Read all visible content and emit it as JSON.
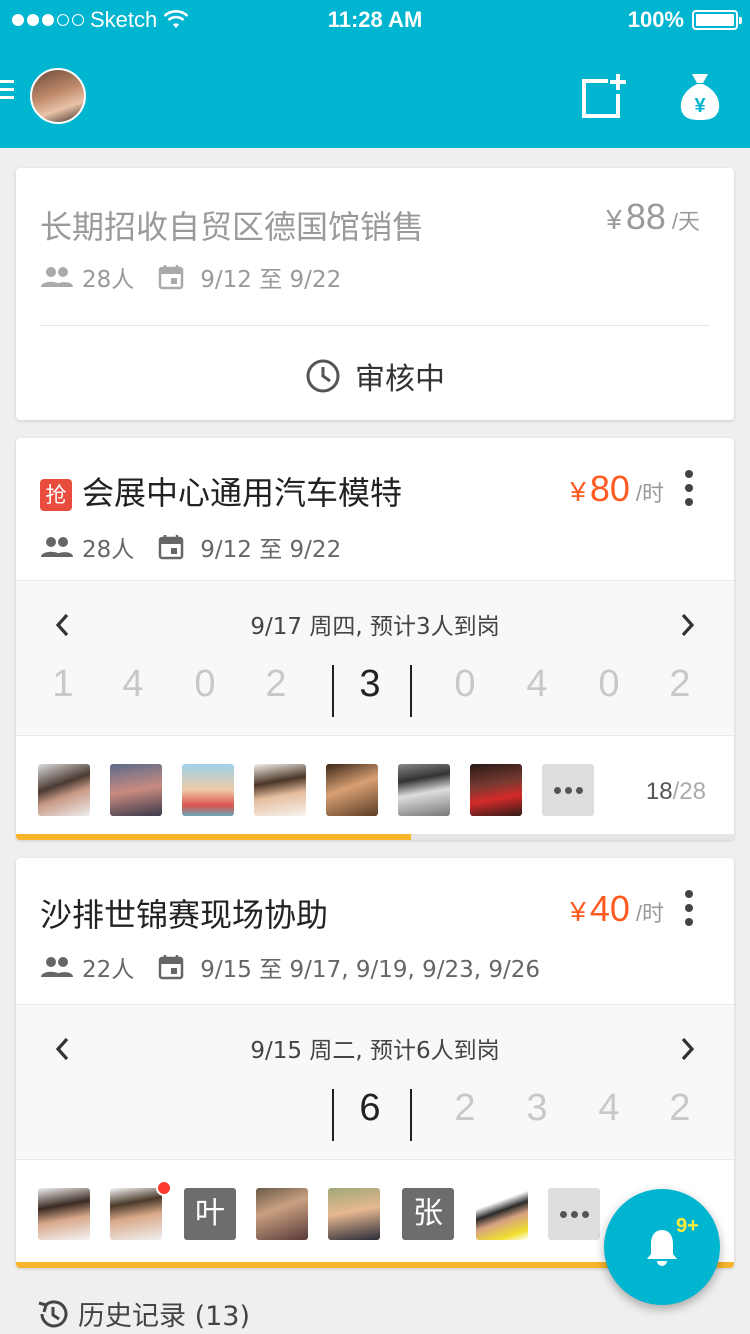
{
  "status_bar": {
    "carrier": "Sketch",
    "time": "11:28 AM",
    "battery": "100%"
  },
  "app_bar": {
    "avatar": "user-avatar",
    "compose_icon": "compose-icon",
    "wallet_icon": "money-bag-yen-icon"
  },
  "jobs": [
    {
      "title": "长期招收自贸区德国馆销售",
      "price_symbol": "¥",
      "price": "88",
      "price_unit": "/天",
      "people": "28人",
      "dates": "9/12 至 9/22",
      "status": "审核中"
    },
    {
      "badge": "抢",
      "title": "会展中心通用汽车模特",
      "price_symbol": "¥",
      "price": "80",
      "price_unit": "/时",
      "people": "28人",
      "dates": "9/12 至 9/22",
      "schedule_text": "9/17 周四, 预计3人到岗",
      "numbers": [
        "1",
        "4",
        "0",
        "2",
        "3",
        "0",
        "4",
        "0",
        "2"
      ],
      "selected_index": 4,
      "filled": "18",
      "total": "/28",
      "progress": 0.55
    },
    {
      "title": "沙排世锦赛现场协助",
      "price_symbol": "¥",
      "price": "40",
      "price_unit": "/时",
      "people": "22人",
      "dates": "9/15 至 9/17, 9/19, 9/23, 9/26",
      "schedule_text": "9/15 周二, 预计6人到岗",
      "numbers": [
        "6",
        "2",
        "3",
        "4",
        "2"
      ],
      "selected_index": 0,
      "avatar_letters": [
        "叶",
        "张"
      ],
      "progress": 1.0
    }
  ],
  "history": {
    "label": "历史记录 (13)"
  },
  "notifications": {
    "badge": "9+"
  },
  "colors": {
    "primary": "#00b5cf",
    "price": "#ff5a1f",
    "progress": "#f7b52c",
    "badge_red": "#e84c3d"
  }
}
